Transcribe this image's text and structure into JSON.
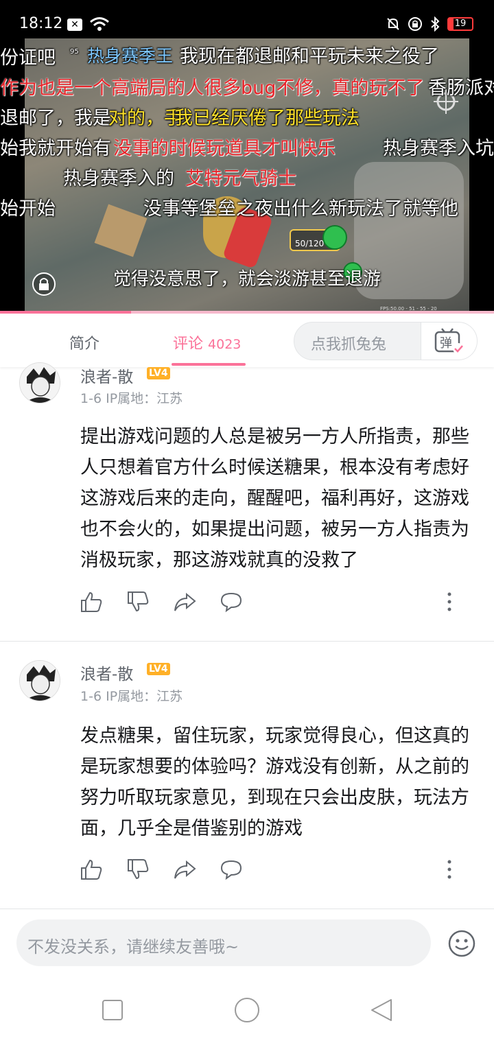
{
  "status_bar": {
    "time": "18:12",
    "battery_level": "19"
  },
  "video": {
    "danmaku": [
      "份证吧",
      "95",
      "热身赛季王",
      "我现在都退邮和平玩未来之役了",
      "作为也是一个高端局的人很多bug不修，真的玩不了",
      "香肠派对",
      "退邮了，我是",
      "对的，手",
      "我已经厌倦了那些玩法",
      "始我就开始有",
      "没事的时候玩道具才叫快乐",
      "热身赛季入坑",
      "热身赛季入的",
      "艾特元气骑士",
      "始开始",
      "没事等堡垒之夜出什么新玩法了就等他"
    ],
    "subtitle": "觉得没意思了，就会淡游甚至退游",
    "hud_ammo": "50/120",
    "hud_fps": "FPS:50.00 - 51 - 55 - 20",
    "progress": 0.265
  },
  "tabs": {
    "intro": "简介",
    "comments": "评论",
    "comment_count": "4023",
    "danmaku_placeholder": "点我抓兔兔",
    "danmaku_button": "弹"
  },
  "comments": [
    {
      "username": "浪者-散",
      "level": "LV4",
      "date": "1-6",
      "ip": "IP属地：江苏",
      "text": "提出游戏问题的人总是被另一方人所指责，那些人只想着官方什么时候送糖果，根本没有考虑好这游戏后来的走向，醒醒吧，福利再好，这游戏也不会火的，如果提出问题，被另一方人指责为消极玩家，那这游戏就真的没救了"
    },
    {
      "username": "浪者-散",
      "level": "LV4",
      "date": "1-6",
      "ip": "IP属地：江苏",
      "text": "发点糖果，留住玩家，玩家觉得良心，但这真的是玩家想要的体验吗？游戏没有创新，从之前的努力听取玩家意见，到现在只会出皮肤，玩法方面，几乎全是借鉴别的游戏"
    }
  ],
  "reply_bar": {
    "placeholder": "不发没关系，请继续友善哦~"
  },
  "colors": {
    "accent": "#fb7299",
    "level_badge": "#ffb027",
    "danmaku_red": "#e8242a",
    "danmaku_yellow": "#ffe22a"
  }
}
